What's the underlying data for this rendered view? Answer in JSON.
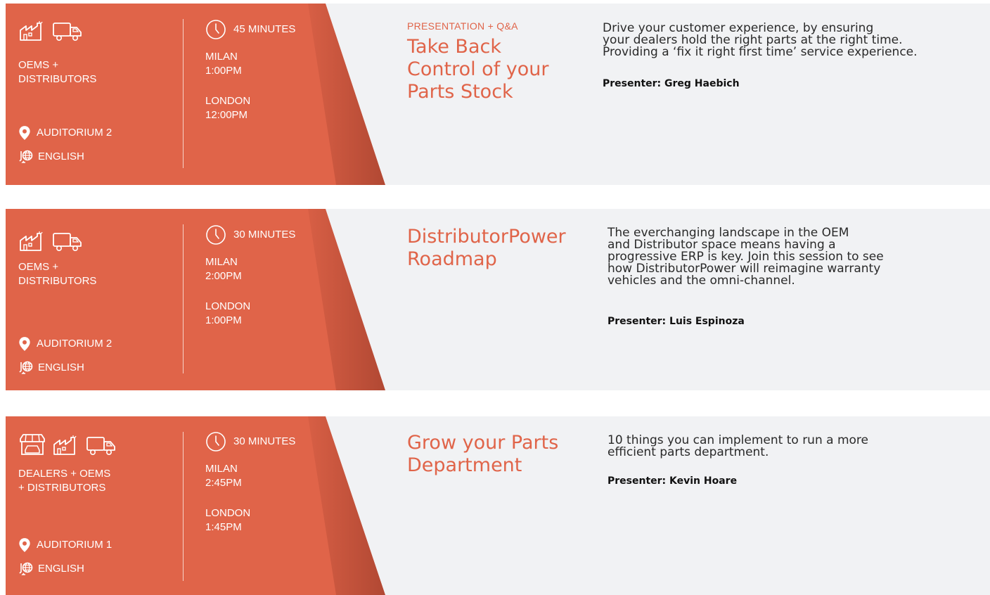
{
  "colors": {
    "accent": "#e06449",
    "panel": "#f1f2f4",
    "text": "#2a2a2a"
  },
  "sessions": [
    {
      "audience_icons": [
        "factory-icon",
        "truck-icon"
      ],
      "audience": "OEMS +\nDISTRIBUTORS",
      "room": "AUDITORIUM 2",
      "language": "ENGLISH",
      "duration": "45 MINUTES",
      "milan_label": "MILAN",
      "milan_time": "1:00PM",
      "london_label": "LONDON",
      "london_time": "12:00PM",
      "tag": "PRESENTATION + Q&A",
      "title": "Take Back\nControl of your\nParts Stock",
      "description": "Drive your customer experience,  by ensuring\nyour dealers hold the right parts at the right time.\nProviding a ‘fix it right first time’ service experience.",
      "presenter": "Presenter: Greg Haebich"
    },
    {
      "audience_icons": [
        "factory-icon",
        "truck-icon"
      ],
      "audience": "OEMS +\nDISTRIBUTORS",
      "room": "AUDITORIUM 2",
      "language": "ENGLISH",
      "duration": "30 MINUTES",
      "milan_label": "MILAN",
      "milan_time": "2:00PM",
      "london_label": "LONDON",
      "london_time": "1:00PM",
      "tag": "",
      "title": "DistributorPower\nRoadmap",
      "description": "The everchanging landscape in the OEM\nand Distributor space means having a\nprogressive ERP is key. Join this session to see\nhow DistributorPower will reimagine warranty\nvehicles and the omni-channel.",
      "presenter": "Presenter: Luis Espinoza"
    },
    {
      "audience_icons": [
        "dealership-icon",
        "factory-icon",
        "truck-icon"
      ],
      "audience": "DEALERS + OEMS\n+ DISTRIBUTORS",
      "room": "AUDITORIUM 1",
      "language": "ENGLISH",
      "duration": "30 MINUTES",
      "milan_label": "MILAN",
      "milan_time": "2:45PM",
      "london_label": "LONDON",
      "london_time": "1:45PM",
      "tag": "",
      "title": "Grow your Parts\nDepartment",
      "description": "10 things you can implement to run a more\nefficient parts department.",
      "presenter": "Presenter: Kevin Hoare"
    }
  ]
}
